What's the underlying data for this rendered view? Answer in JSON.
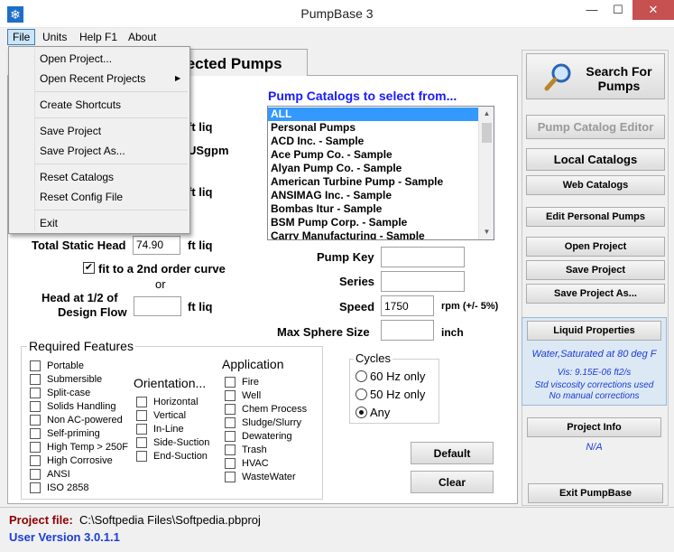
{
  "window": {
    "title": "PumpBase 3",
    "minimize": "—",
    "maximize": "☐",
    "close": "✕"
  },
  "menu": [
    "File",
    "Units",
    "Help F1",
    "About"
  ],
  "file_menu": {
    "items": [
      "Open Project...",
      "Open Recent Projects",
      "Create Shortcuts",
      "Save Project",
      "Save Project As...",
      "Reset Catalogs",
      "Reset Config File",
      "Exit"
    ]
  },
  "tab": {
    "label": "Selected Pumps",
    "visible_label": "lected Pumps"
  },
  "partial_units": {
    "u1": "ft liq",
    "u2": "USgpm",
    "u3": "ft liq"
  },
  "static_head": {
    "label": "Total Static Head",
    "value": "74.90",
    "unit": "ft liq"
  },
  "fit_curve": {
    "label": "fit to a 2nd order curve",
    "checked": true
  },
  "or_label": "or",
  "head_half": {
    "label1": "Head at 1/2 of",
    "label2": "Design Flow",
    "value": "",
    "unit": "ft liq"
  },
  "catalogs": {
    "title": "Pump Catalogs to select from...",
    "items": [
      "ALL",
      "Personal Pumps",
      "ACD Inc. - Sample",
      "Ace Pump Co. - Sample",
      "Alyan Pump Co. - Sample",
      "American Turbine Pump - Sample",
      "ANSIMAG Inc. - Sample",
      "Bombas Itur - Sample",
      "BSM Pump Corp. - Sample",
      "Carry Manufacturing - Sample"
    ],
    "selected": 0
  },
  "pump_key": {
    "label": "Pump Key",
    "value": ""
  },
  "series": {
    "label": "Series",
    "value": ""
  },
  "speed": {
    "label": "Speed",
    "value": "1750",
    "unit": "rpm (+/- 5%)"
  },
  "sphere": {
    "label": "Max Sphere Size",
    "value": "",
    "unit": "inch"
  },
  "required_features": {
    "title": "Required Features",
    "items": [
      "Portable",
      "Submersible",
      "Split-case",
      "Solids Handling",
      "Non AC-powered",
      "Self-priming",
      "High Temp > 250F",
      "High Corrosive",
      "ANSI",
      "ISO 2858"
    ]
  },
  "orientation": {
    "title": "Orientation...",
    "items": [
      "Horizontal",
      "Vertical",
      "In-Line",
      "Side-Suction",
      "End-Suction"
    ]
  },
  "application": {
    "title": "Application",
    "items": [
      "Fire",
      "Well",
      "Chem Process",
      "Sludge/Slurry",
      "Dewatering",
      "Trash",
      "HVAC",
      "WasteWater"
    ]
  },
  "cycles": {
    "title": "Cycles",
    "options": [
      "60 Hz only",
      "50 Hz only",
      "Any"
    ],
    "selected": 2
  },
  "buttons": {
    "default": "Default",
    "clear": "Clear",
    "search1": "Search For",
    "search2": "Pumps",
    "catalog_editor": "Pump Catalog Editor",
    "local_catalogs": "Local Catalogs",
    "web_catalogs": "Web Catalogs",
    "edit_personal": "Edit Personal Pumps",
    "open_project": "Open Project",
    "save_project": "Save Project",
    "save_project_as": "Save Project As...",
    "liquid_properties": "Liquid Properties",
    "project_info": "Project Info",
    "exit": "Exit PumpBase"
  },
  "liquid": {
    "name": "Water,Saturated at  80 deg F",
    "vis": "Vis: 9.15E-06 ft2/s",
    "note1": "Std viscosity corrections used",
    "note2": "No manual corrections"
  },
  "project_info_value": "N/A",
  "status": {
    "project_label": "Project file:",
    "project_path": "C:\\Softpedia Files\\Softpedia.pbproj",
    "version": "User Version 3.0.1.1"
  },
  "colors": {
    "accent": "#1a1aff",
    "selection": "#3399ff",
    "status_label": "#8b0000",
    "version": "#1a3dd6"
  }
}
